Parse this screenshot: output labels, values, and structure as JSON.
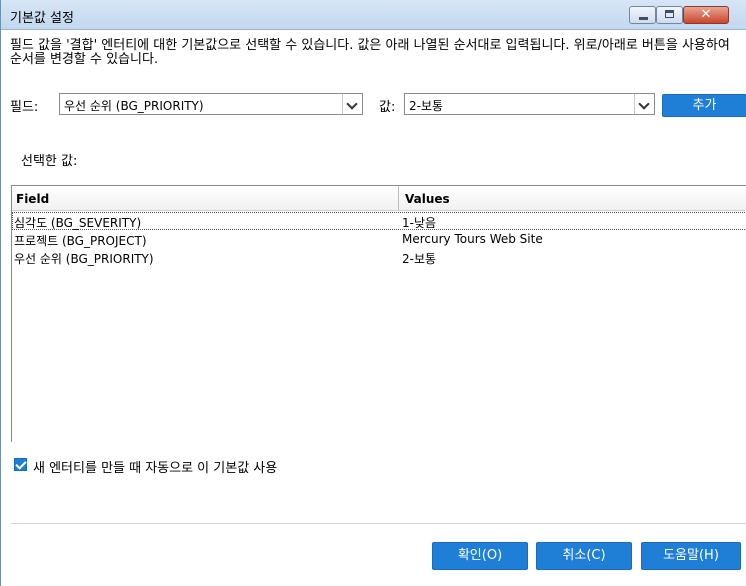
{
  "window": {
    "title": "기본값 설정"
  },
  "description": "필드 값을 '결합' 엔터티에 대한 기본값으로 선택할 수 있습니다. 값은 아래 나열된 순서대로 입력됩니다. 위로/아래로 버튼을 사용하여 순서를 변경할 수 있습니다.",
  "form": {
    "field_label": "필드:",
    "field_value": "우선 순위 (BG_PRIORITY)",
    "value_label": "값:",
    "value_value": "2-보통",
    "add_label": "추가"
  },
  "selected_label": "선택한 값:",
  "grid": {
    "headers": {
      "field": "Field",
      "values": "Values"
    },
    "rows": [
      {
        "field": "심각도 (BG_SEVERITY)",
        "value": "1-낮음"
      },
      {
        "field": "프로젝트 (BG_PROJECT)",
        "value": "Mercury Tours Web Site"
      },
      {
        "field": "우선 순위 (BG_PRIORITY)",
        "value": "2-보통"
      }
    ]
  },
  "checkbox": {
    "label": "새 엔터티를 만들 때 자동으로 이 기본값 사용",
    "checked": true
  },
  "buttons": {
    "ok": "확인(O)",
    "cancel": "취소(C)",
    "help": "도움말(H)"
  },
  "colors": {
    "accent": "#1f7fd6",
    "titlebar": "#c9dcf0"
  }
}
